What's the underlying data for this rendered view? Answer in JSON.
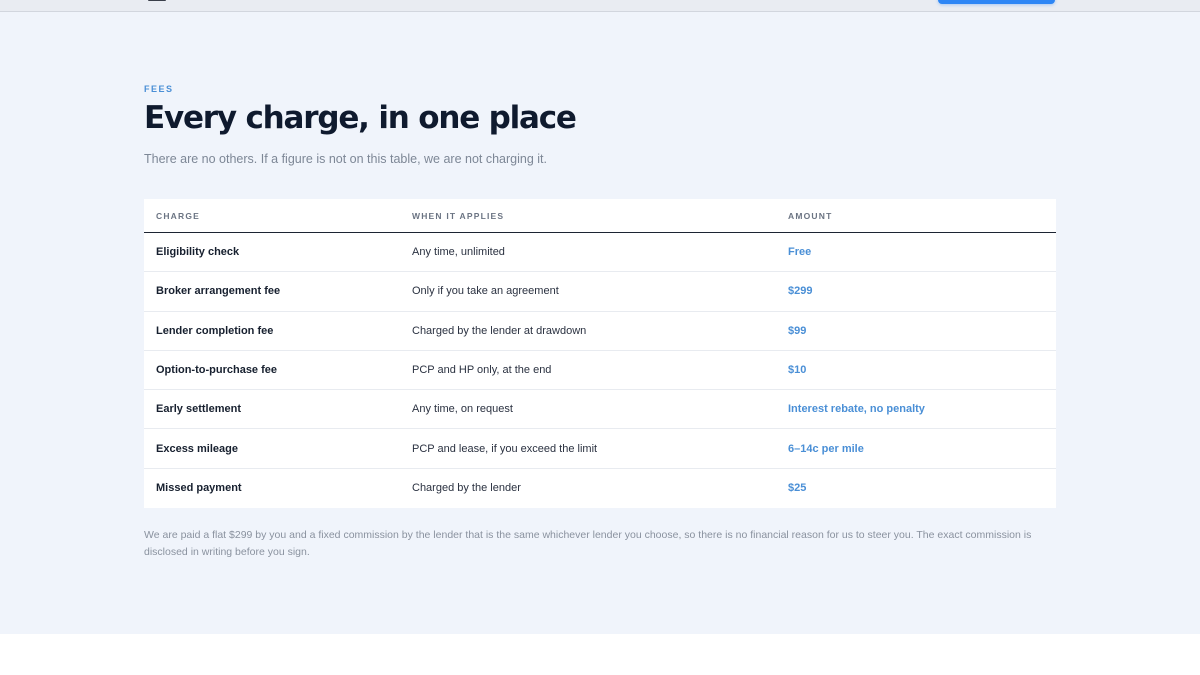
{
  "section": {
    "eyebrow": "FEES",
    "title": "Every charge, in one place",
    "subtitle": "There are no others. If a figure is not on this table, we are not charging it.",
    "note": "We are paid a flat $299 by you and a fixed commission by the lender that is the same whichever lender you choose, so there is no financial reason for us to steer you. The exact commission is disclosed in writing before you sign."
  },
  "table": {
    "headers": [
      "CHARGE",
      "WHEN IT APPLIES",
      "AMOUNT"
    ],
    "rows": [
      {
        "charge": "Eligibility check",
        "when": "Any time, unlimited",
        "amount": "Free"
      },
      {
        "charge": "Broker arrangement fee",
        "when": "Only if you take an agreement",
        "amount": "$299"
      },
      {
        "charge": "Lender completion fee",
        "when": "Charged by the lender at drawdown",
        "amount": "$99"
      },
      {
        "charge": "Option-to-purchase fee",
        "when": "PCP and HP only, at the end",
        "amount": "$10"
      },
      {
        "charge": "Early settlement",
        "when": "Any time, on request",
        "amount": "Interest rebate, no penalty"
      },
      {
        "charge": "Excess mileage",
        "when": "PCP and lease, if you exceed the limit",
        "amount": "6–14c per mile"
      },
      {
        "charge": "Missed payment",
        "when": "Charged by the lender",
        "amount": "$25"
      }
    ]
  },
  "colors": {
    "accent": "#4a8fd6",
    "heading": "#0f1a2e",
    "section_bg": "#f0f4fb",
    "cta": "#2d86f5"
  }
}
